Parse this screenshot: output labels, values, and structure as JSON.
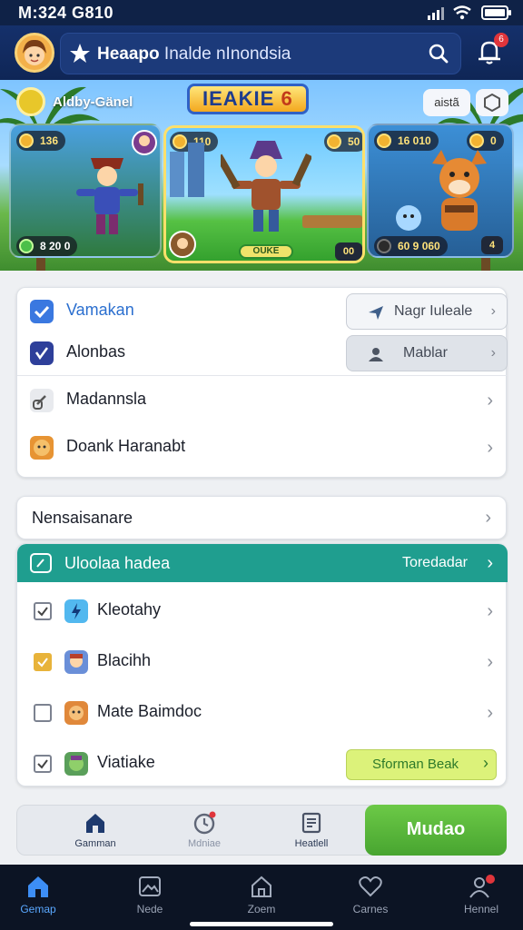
{
  "status": {
    "time": "M:324 G810"
  },
  "header": {
    "brand": "Heaapo",
    "subtitle": "Inalde nInondsia"
  },
  "banner": {
    "level_label": "Aldby-Gänel",
    "title": "IEAKIE",
    "title_suffix": "6",
    "top_button": "aistã",
    "left_coins": "136",
    "left_bottom": "8 20 0",
    "mid_coins": "110",
    "mid_button": "OUKE",
    "mid_badge": "00",
    "right_coins_a": "50",
    "right_coins_b": "16 010",
    "right_coins_c": "0",
    "right_bottom": "60 9 060",
    "right_badge": "4"
  },
  "section1": {
    "items": [
      {
        "label": "Vamakan",
        "icon": "check-icon",
        "btn": "Nagr Iuleale"
      },
      {
        "label": "Alonbas",
        "icon": "check-icon-dark",
        "btn": "Mablar"
      },
      {
        "label": "Madannsla",
        "icon": "link-icon"
      },
      {
        "label": "Doank Haranabt",
        "icon": "lion-icon"
      }
    ]
  },
  "section2": {
    "header": "Nensaisanare",
    "teal_title": "Uloolaa hadea",
    "teal_action": "Toredadar",
    "items": [
      {
        "label": "Kleotahy",
        "checked": true,
        "icon": "lightning-icon"
      },
      {
        "label": "Blacihh",
        "checked": true,
        "icon": "character-icon"
      },
      {
        "label": "Mate Baimdoc",
        "checked": false,
        "icon": "monkey-icon"
      },
      {
        "label": "Viatiake",
        "checked": true,
        "icon": "goblin-icon",
        "btn": "Sforman Beak"
      }
    ]
  },
  "cta": {
    "items": [
      {
        "label": "Gamman",
        "icon": "home-icon"
      },
      {
        "label": "Mdniae",
        "icon": "timer-icon"
      },
      {
        "label": "Heatlell",
        "icon": "document-icon"
      }
    ],
    "button": "Mudao"
  },
  "tabs": [
    {
      "label": "Gemap",
      "icon": "home-icon",
      "active": true
    },
    {
      "label": "Nede",
      "icon": "image-icon",
      "active": false
    },
    {
      "label": "Zoem",
      "icon": "house-outline-icon",
      "active": false
    },
    {
      "label": "Carnes",
      "icon": "heart-icon",
      "active": false
    },
    {
      "label": "Hennel",
      "icon": "users-icon",
      "active": false
    }
  ],
  "colors": {
    "primary": "#0f2656",
    "teal": "#1f9e8f",
    "green": "#48a530",
    "accent_blue": "#3a78e0"
  }
}
